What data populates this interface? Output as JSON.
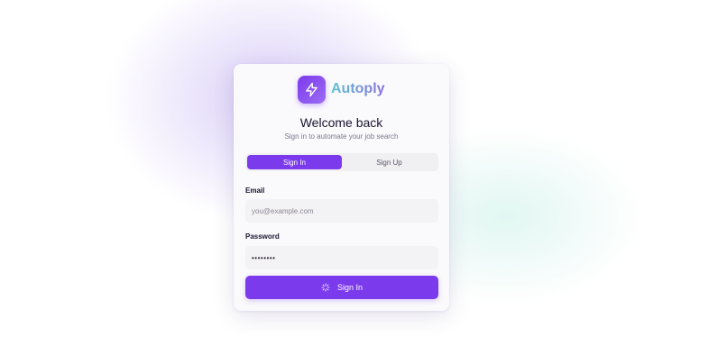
{
  "brand": {
    "name": "Autoply",
    "logo_icon": "lightning-bolt-icon"
  },
  "heading": {
    "title": "Welcome back",
    "subtitle": "Sign in to automate your job search"
  },
  "tabs": [
    {
      "label": "Sign In",
      "active": true
    },
    {
      "label": "Sign Up",
      "active": false
    }
  ],
  "form": {
    "email_label": "Email",
    "email_placeholder": "you@example.com",
    "email_value": "",
    "password_label": "Password",
    "password_value": "••••••••",
    "submit_label": "Sign In",
    "submit_icon": "sparkles-icon"
  },
  "colors": {
    "accent": "#7c3aed",
    "brand_gradient_start": "#5cc3cf",
    "brand_gradient_end": "#8a70e0"
  }
}
